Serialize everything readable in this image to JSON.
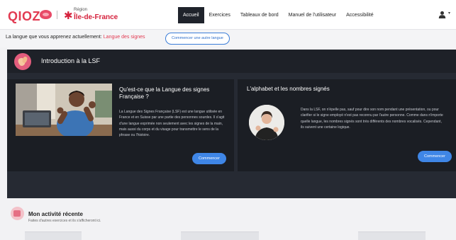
{
  "header": {
    "logo_text": "QIOZ",
    "region_prefix": "Région",
    "region_name": "Île-de-France",
    "nav": [
      {
        "label": "Accueil",
        "active": true
      },
      {
        "label": "Exercices",
        "active": false
      },
      {
        "label": "Tableaux de bord",
        "active": false
      },
      {
        "label": "Manuel de l'utilisateur",
        "active": false
      },
      {
        "label": "Accessibilité",
        "active": false
      }
    ],
    "user_icon": "user-icon"
  },
  "language_bar": {
    "label": "La langue que vous apprenez actuellement:",
    "value": "Langue des signes",
    "change_button": "Commencer une autre langue"
  },
  "intro": {
    "title": "Introduction à la LSF",
    "cards": [
      {
        "title": "Qu'est-ce que la Langue des signes Française ?",
        "body": "La Langue des Signes Française (LSF) est une langue utilisée en France et en Suisse par une partie des personnes sourdes. Il s'agit d'une langue exprimée non seulement avec les signes de la main, mais aussi du corps et du visage pour transmettre le sens de la phrase ou l'histoire.",
        "button": "Commencer"
      },
      {
        "title": "L'alphabet et les nombres signés",
        "body": "Dans la LSF, on n'épelle pas, sauf pour dire son nom pendant une présentation, ou pour clarifier si le signe employé n'est pas reconnu par l'autre personne. Comme dans n'importe quelle langue, les nombres signés sont très différents des nombres vocalisés. Cependant, ils suivent une certaine logique.",
        "button": "Commencer"
      }
    ]
  },
  "activity": {
    "title": "Mon activité récente",
    "subtitle": "Faites d'autres exercices et ils s'afficheront ici."
  },
  "colors": {
    "brand": "#e23b52",
    "panel": "#262a33",
    "card": "#1b1e24",
    "button": "#3f86e6"
  }
}
